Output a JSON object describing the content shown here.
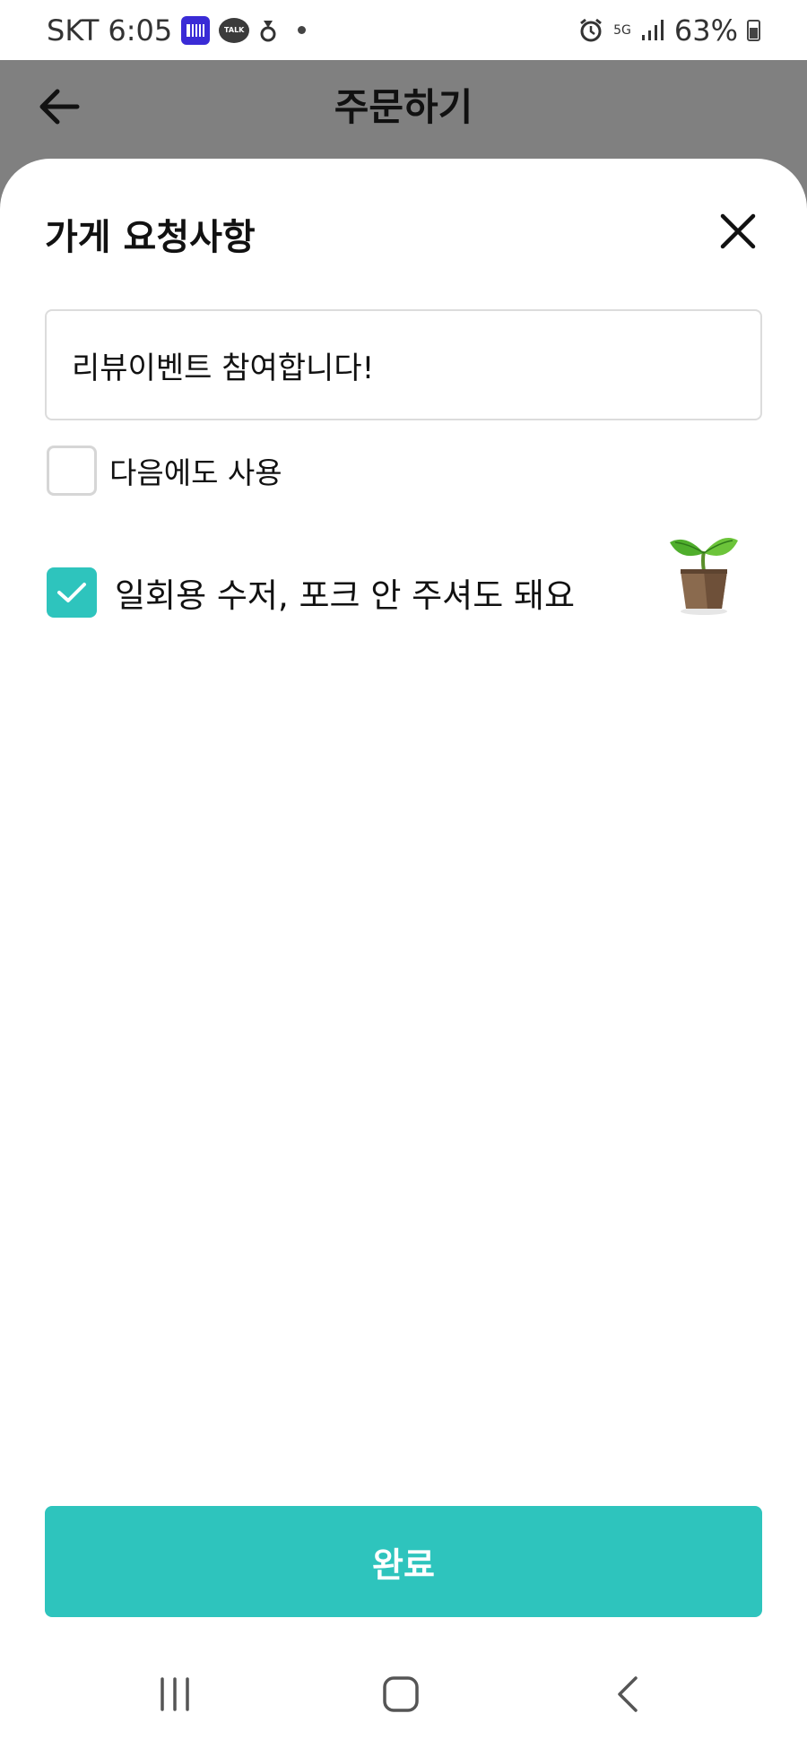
{
  "status_bar": {
    "carrier": "SKT",
    "time": "6:05",
    "talk_badge": "TALK",
    "network": "5G",
    "battery": "63%"
  },
  "header": {
    "title": "주문하기"
  },
  "sheet": {
    "title": "가게 요청사항",
    "request_input_value": "리뷰이벤트 참여합니다!",
    "reuse_option": {
      "label": "다음에도 사용",
      "checked": false
    },
    "no_utensils_option": {
      "label": "일회용 수저, 포크 안 주셔도 돼요",
      "checked": true
    },
    "complete_label": "완료"
  },
  "colors": {
    "accent": "#2ec4bd",
    "dim_overlay": "#808080"
  },
  "icons": [
    "back-arrow-icon",
    "close-icon",
    "checkmark-icon",
    "plant-icon",
    "recent-apps-icon",
    "home-icon",
    "nav-back-icon"
  ]
}
